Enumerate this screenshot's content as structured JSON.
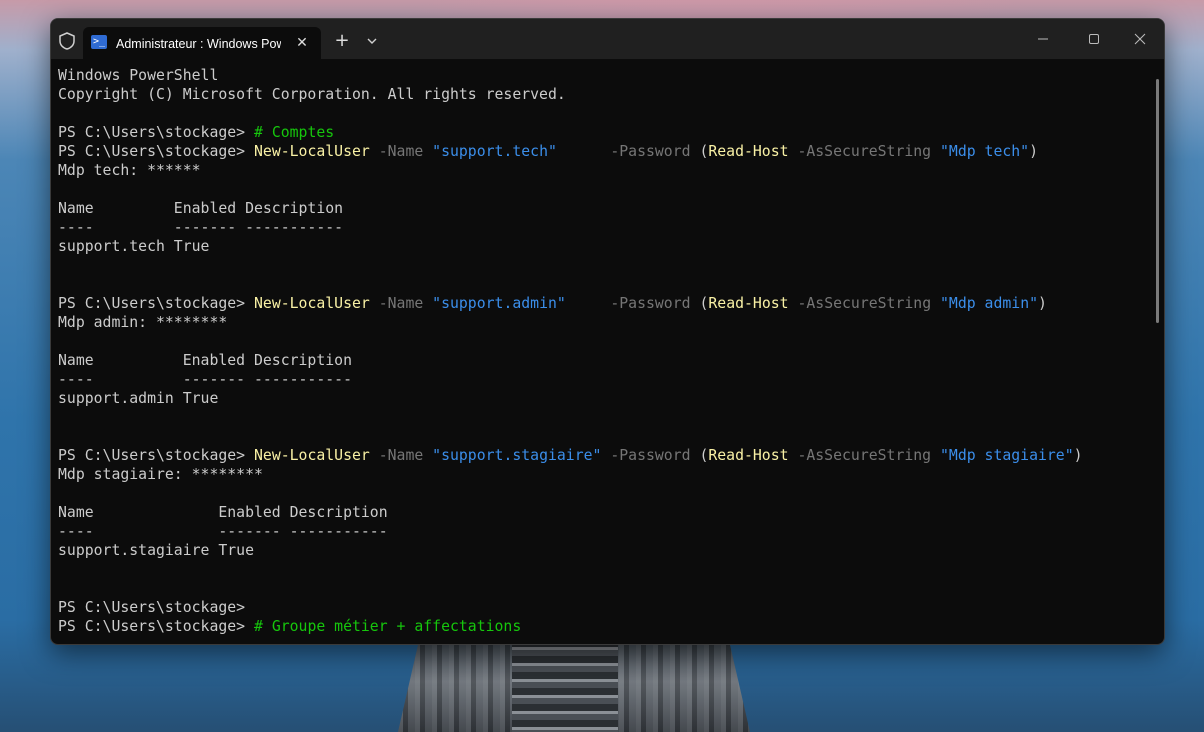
{
  "window": {
    "tab_title": "Administrateur : Windows PowerShell",
    "tab_icon": "powershell-icon",
    "new_tab_label": "+",
    "close_tab_label": "✕"
  },
  "terminal": {
    "lines": [
      [
        {
          "t": "Windows PowerShell",
          "c": ""
        }
      ],
      [
        {
          "t": "Copyright (C) Microsoft Corporation. All rights reserved.",
          "c": ""
        }
      ],
      [],
      [
        {
          "t": "PS C:\\Users\\stockage> ",
          "c": ""
        },
        {
          "t": "# Comptes",
          "c": "cmt"
        }
      ],
      [
        {
          "t": "PS C:\\Users\\stockage> ",
          "c": ""
        },
        {
          "t": "New-LocalUser",
          "c": "cmd"
        },
        {
          "t": " -Name ",
          "c": "param"
        },
        {
          "t": "\"support.tech\"",
          "c": "str"
        },
        {
          "t": "      -Password ",
          "c": "param"
        },
        {
          "t": "(",
          "c": ""
        },
        {
          "t": "Read-Host",
          "c": "cmd"
        },
        {
          "t": " -AsSecureString ",
          "c": "param"
        },
        {
          "t": "\"Mdp tech\"",
          "c": "str"
        },
        {
          "t": ")",
          "c": ""
        }
      ],
      [
        {
          "t": "Mdp tech: ******",
          "c": ""
        }
      ],
      [],
      [
        {
          "t": "Name         Enabled Description",
          "c": ""
        }
      ],
      [
        {
          "t": "----         ------- -----------",
          "c": ""
        }
      ],
      [
        {
          "t": "support.tech True",
          "c": ""
        }
      ],
      [],
      [],
      [
        {
          "t": "PS C:\\Users\\stockage> ",
          "c": ""
        },
        {
          "t": "New-LocalUser",
          "c": "cmd"
        },
        {
          "t": " -Name ",
          "c": "param"
        },
        {
          "t": "\"support.admin\"",
          "c": "str"
        },
        {
          "t": "     -Password ",
          "c": "param"
        },
        {
          "t": "(",
          "c": ""
        },
        {
          "t": "Read-Host",
          "c": "cmd"
        },
        {
          "t": " -AsSecureString ",
          "c": "param"
        },
        {
          "t": "\"Mdp admin\"",
          "c": "str"
        },
        {
          "t": ")",
          "c": ""
        }
      ],
      [
        {
          "t": "Mdp admin: ********",
          "c": ""
        }
      ],
      [],
      [
        {
          "t": "Name          Enabled Description",
          "c": ""
        }
      ],
      [
        {
          "t": "----          ------- -----------",
          "c": ""
        }
      ],
      [
        {
          "t": "support.admin True",
          "c": ""
        }
      ],
      [],
      [],
      [
        {
          "t": "PS C:\\Users\\stockage> ",
          "c": ""
        },
        {
          "t": "New-LocalUser",
          "c": "cmd"
        },
        {
          "t": " -Name ",
          "c": "param"
        },
        {
          "t": "\"support.stagiaire\"",
          "c": "str"
        },
        {
          "t": " -Password ",
          "c": "param"
        },
        {
          "t": "(",
          "c": ""
        },
        {
          "t": "Read-Host",
          "c": "cmd"
        },
        {
          "t": " -AsSecureString ",
          "c": "param"
        },
        {
          "t": "\"Mdp stagiaire\"",
          "c": "str"
        },
        {
          "t": ")",
          "c": ""
        }
      ],
      [
        {
          "t": "Mdp stagiaire: ********",
          "c": ""
        }
      ],
      [],
      [
        {
          "t": "Name              Enabled Description",
          "c": ""
        }
      ],
      [
        {
          "t": "----              ------- -----------",
          "c": ""
        }
      ],
      [
        {
          "t": "support.stagiaire True",
          "c": ""
        }
      ],
      [],
      [],
      [
        {
          "t": "PS C:\\Users\\stockage>",
          "c": ""
        }
      ],
      [
        {
          "t": "PS C:\\Users\\stockage> ",
          "c": ""
        },
        {
          "t": "# Groupe métier + affectations",
          "c": "cmt"
        }
      ]
    ]
  },
  "colors": {
    "terminal_bg": "#0c0c0c",
    "text": "#cccccc",
    "command": "#f9f1a5",
    "parameter": "#767676",
    "string": "#3b8eea",
    "comment": "#16c60c"
  }
}
